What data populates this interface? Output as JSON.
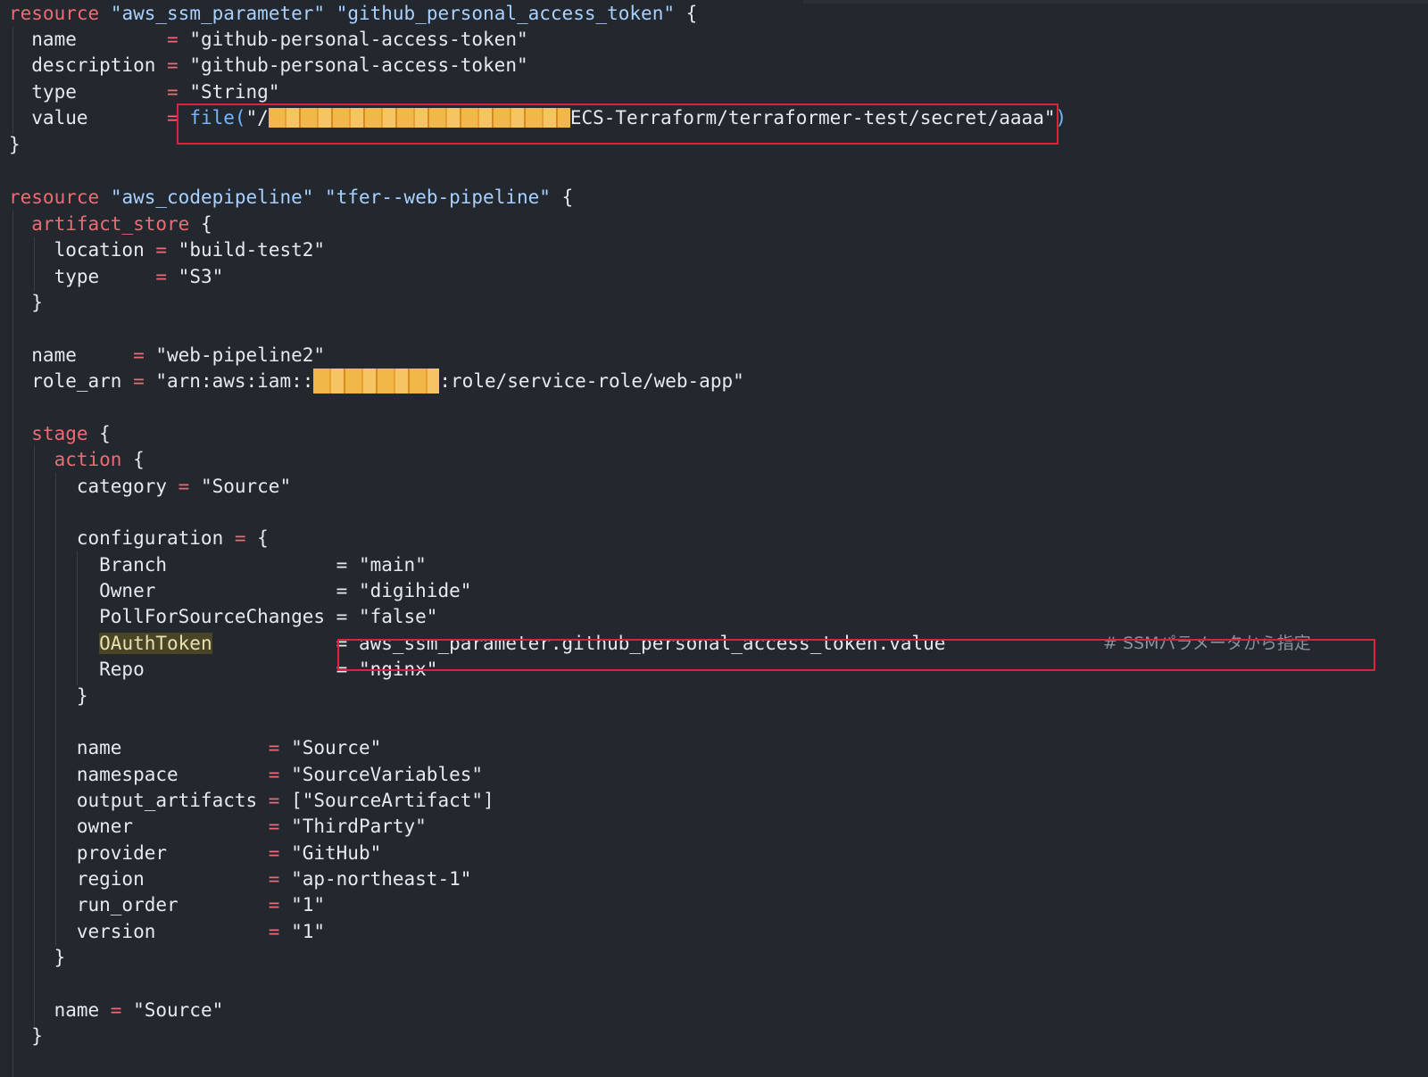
{
  "colors": {
    "background": "#23272e",
    "keyword": "#ef6b73",
    "string": "#a8d1ff",
    "text": "#e6e9ee",
    "function": "#74b7ff",
    "comment": "#8b929b",
    "highlight_box": "#e0213b",
    "redaction": "#f0b848"
  },
  "blocks": {
    "ssm": {
      "kw": "resource",
      "type": "\"aws_ssm_parameter\"",
      "resname": "\"github_personal_access_token\"",
      "open": " {",
      "name_key": "  name        ",
      "name_eq": "= ",
      "name_val": "\"github-personal-access-token\"",
      "desc_key": "  description ",
      "desc_eq": "= ",
      "desc_val": "\"github-personal-access-token\"",
      "type_key": "  type        ",
      "type_eq": "= ",
      "type_val": "\"String\"",
      "value_key": "  value       ",
      "value_eq": "= ",
      "value_fn": "file(",
      "value_str_start": "\"/",
      "value_str_end": "ECS-Terraform/terraformer-test/secret/aaaa\"",
      "value_close": ")",
      "close": "}"
    },
    "pipeline": {
      "kw": "resource",
      "type": "\"aws_codepipeline\"",
      "resname": "\"tfer--web-pipeline\"",
      "open": " {",
      "artifact_store": "artifact_store",
      "artifact_open": " {",
      "location_key": "    location ",
      "location_eq": "= ",
      "location_val": "\"build-test2\"",
      "astype_key": "    type     ",
      "astype_eq": "= ",
      "astype_val": "\"S3\"",
      "artifact_close": "  }",
      "name_key": "  name     ",
      "name_eq": "= ",
      "name_val": "\"web-pipeline2\"",
      "role_key": "  role_arn ",
      "role_eq": "= ",
      "role_val_start": "\"arn:aws:iam::",
      "role_val_end": ":role/service-role/web-app\"",
      "stage": "stage",
      "stage_open": " {",
      "action": "action",
      "action_open": " {",
      "category_key": "      category ",
      "category_eq": "= ",
      "category_val": "\"Source\"",
      "configuration_key": "      configuration ",
      "configuration_eq": "= ",
      "configuration_open": "{",
      "branch_key": "        Branch               ",
      "branch_eq": "= ",
      "branch_val": "\"main\"",
      "owner_key": "        Owner                ",
      "owner_eq": "= ",
      "owner_val": "\"digihide\"",
      "poll_key": "        PollForSourceChanges ",
      "poll_eq": "= ",
      "poll_val": "\"false\"",
      "oauth_key": "OAuthToken",
      "oauth_pad": "           ",
      "oauth_eq": "= ",
      "oauth_val": "aws_ssm_parameter.github_personal_access_token.value",
      "oauth_comment": "# SSMパラメータから指定",
      "repo_key": "        Repo                 ",
      "repo_eq": "= ",
      "repo_val": "\"nginx\"",
      "configuration_close": "      }",
      "a_name_key": "      name             ",
      "a_name_eq": "= ",
      "a_name_val": "\"Source\"",
      "namespace_key": "      namespace        ",
      "namespace_eq": "= ",
      "namespace_val": "\"SourceVariables\"",
      "output_key": "      output_artifacts ",
      "output_eq": "= ",
      "output_val": "[\"SourceArtifact\"]",
      "a_owner_key": "      owner            ",
      "a_owner_eq": "= ",
      "a_owner_val": "\"ThirdParty\"",
      "provider_key": "      provider         ",
      "provider_eq": "= ",
      "provider_val": "\"GitHub\"",
      "region_key": "      region           ",
      "region_eq": "= ",
      "region_val": "\"ap-northeast-1\"",
      "run_order_key": "      run_order        ",
      "run_order_eq": "= ",
      "run_order_val": "\"1\"",
      "version_key": "      version          ",
      "version_eq": "= ",
      "version_val": "\"1\"",
      "action_close": "    }",
      "s_name_key": "    name ",
      "s_name_eq": "= ",
      "s_name_val": "\"Source\"",
      "stage_close": "  }"
    }
  }
}
